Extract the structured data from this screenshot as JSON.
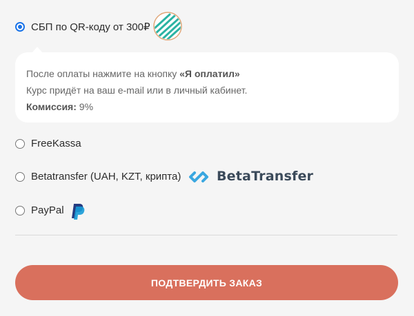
{
  "payment_options": [
    {
      "id": "sbp",
      "label": "СБП по QR-коду от 300₽",
      "selected": true,
      "logo_icon": "sbp-logo-icon"
    },
    {
      "id": "freekassa",
      "label": "FreeKassa",
      "selected": false
    },
    {
      "id": "betatransfer",
      "label": "Betatransfer (UAH, KZT, крипта)",
      "selected": false,
      "logo_text": "BetaTransfer",
      "logo_icon": "betatransfer-logo-icon"
    },
    {
      "id": "paypal",
      "label": "PayPal",
      "selected": false,
      "logo_icon": "paypal-logo-icon"
    }
  ],
  "info": {
    "line1_prefix": "После оплаты нажмите на кнопку ",
    "line1_bold": "«Я оплатил»",
    "line2": "Курс придёт на ваш e-mail или в личный кабинет.",
    "commission_label": "Комиссия:",
    "commission_value": " 9%"
  },
  "confirm_button": {
    "label": "ПОДТВЕРДИТЬ ЗАКАЗ"
  },
  "colors": {
    "accent_radio": "#1a73e8",
    "button": "#d9705d",
    "background": "#f5f5f5",
    "betatransfer_logo": "#3aa7e0",
    "sbp_logo": "#2bb3a3",
    "paypal_dark": "#253b80",
    "paypal_light": "#179bd7"
  }
}
